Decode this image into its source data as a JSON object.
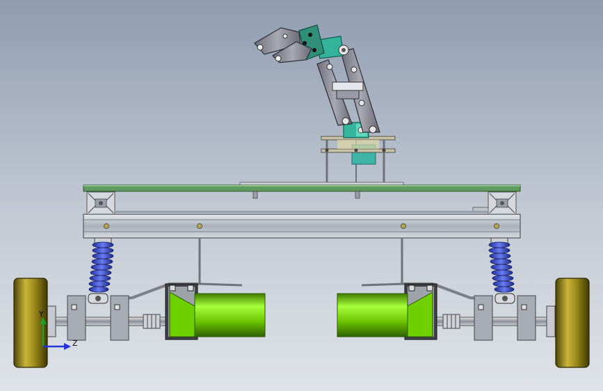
{
  "viewport": {
    "background_top": "#8f9cb0",
    "background_bottom": "#dfe3e8"
  },
  "triad": {
    "y_label": "Y",
    "z_label": "Z",
    "y_color": "#20a020",
    "z_color": "#2233dd"
  },
  "colors": {
    "deck": "#5f9a5f",
    "frame": "#b9bfc8",
    "spring": "#3f51c9",
    "motor": "#7fe000",
    "wheel": "#b8a722",
    "servo": "#33b39a",
    "arm_link": "#8a8a96"
  }
}
